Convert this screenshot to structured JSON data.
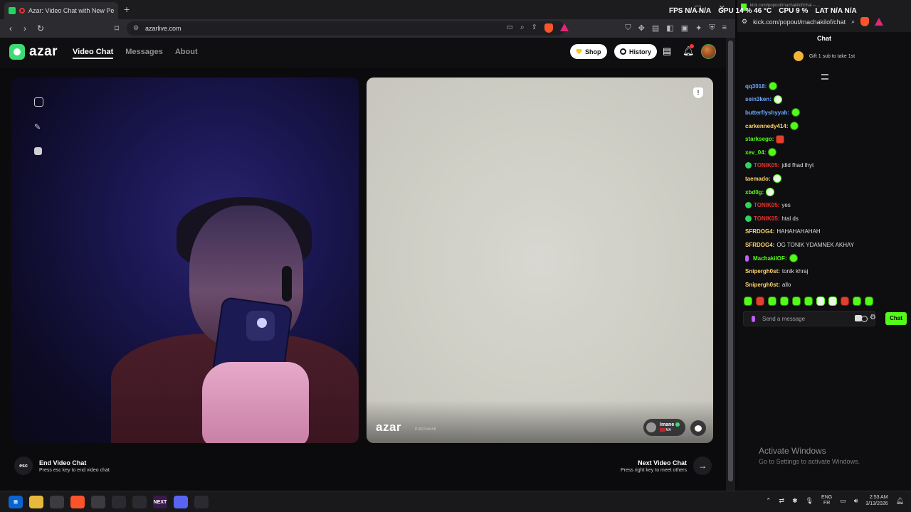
{
  "browser": {
    "tab_title": "Azar: Video Chat with New Pe",
    "tab_close": "×",
    "new_tab": "+",
    "url": "azarlive.com"
  },
  "azar": {
    "logo": "azar",
    "nav": [
      "Video Chat",
      "Messages",
      "About"
    ],
    "shop_label": "Shop",
    "history_label": "History",
    "peer_logo": "azar",
    "peer_code": "P.3917v4nX8",
    "peer_name": "Imane",
    "peer_country": "MA",
    "end_key": "esc",
    "end_title": "End Video Chat",
    "end_sub": "Press esc key to end video chat",
    "next_title": "Next Video Chat",
    "next_sub": "Press right key to meet others",
    "next_arrow": "→"
  },
  "overlay": {
    "fps_label": "FPS",
    "fps_value": "N/A",
    "fps_value2": "N/A",
    "gpu": "GPU  14 %  46 °C",
    "cpu": "CPU  9 %",
    "lat_label": "LAT",
    "lat_value": "N/A",
    "lat_value2": "N/A"
  },
  "kick": {
    "tiny_title": "kick.com/popout/machakilof/chat – ...",
    "url": "kick.com/popout/machakilof/chat",
    "chat_title": "Chat",
    "gift_text": "Gift 1 sub to take 1st",
    "messages": [
      {
        "user": "qq3018",
        "color": "#6fa8ff",
        "text": "",
        "emote": "green",
        "verified": false,
        "mic": false
      },
      {
        "user": "sein3ken",
        "color": "#6fa8ff",
        "text": "",
        "emote": "white",
        "verified": false,
        "mic": false
      },
      {
        "user": "butterflyshyyah",
        "color": "#6fa8ff",
        "text": "",
        "emote": "green",
        "verified": false,
        "mic": false
      },
      {
        "user": "carkennedy414",
        "color": "#ffd36b",
        "text": "",
        "emote": "green",
        "verified": false,
        "mic": false
      },
      {
        "user": "starksego",
        "color": "#53fc18",
        "text": "",
        "emote": "red",
        "verified": false,
        "mic": false
      },
      {
        "user": "xev_04",
        "color": "#53fc18",
        "text": "",
        "emote": "green",
        "verified": false,
        "mic": false
      },
      {
        "user": "TONIK05",
        "color": "#e5342e",
        "text": "jdld fhad lhyt",
        "emote": "",
        "verified": true,
        "mic": false
      },
      {
        "user": "taemado",
        "color": "#ffd36b",
        "text": "",
        "emote": "white",
        "verified": false,
        "mic": false
      },
      {
        "user": "xbd0g",
        "color": "#53fc18",
        "text": "",
        "emote": "white",
        "verified": false,
        "mic": false
      },
      {
        "user": "TONIK05",
        "color": "#e5342e",
        "text": "yes",
        "emote": "",
        "verified": true,
        "mic": false
      },
      {
        "user": "TONIK05",
        "color": "#e5342e",
        "text": "htal ds",
        "emote": "",
        "verified": true,
        "mic": false
      },
      {
        "user": "SFRDOG4",
        "color": "#ffd36b",
        "text": "HAHAHAHAHAH",
        "emote": "",
        "verified": false,
        "mic": false
      },
      {
        "user": "SFRDOG4",
        "color": "#ffd36b",
        "text": "OG TONIK YDAMNEK AKHAY",
        "emote": "",
        "verified": false,
        "mic": false
      },
      {
        "user": "MachakilOF",
        "color": "#53fc18",
        "text": "",
        "emote": "green",
        "verified": false,
        "mic": true
      },
      {
        "user": "Snipergh0st",
        "color": "#ffd36b",
        "text": "tonik khraj",
        "emote": "",
        "verified": false,
        "mic": false
      },
      {
        "user": "Snipergh0st",
        "color": "#ffd36b",
        "text": "allo",
        "emote": "",
        "verified": false,
        "mic": false
      }
    ],
    "emote_bar": [
      "green",
      "red",
      "green",
      "green",
      "green",
      "green",
      "white",
      "white",
      "red",
      "green",
      "green"
    ],
    "input_placeholder": "Send a message",
    "send_label": "Chat",
    "activate_title": "Activate Windows",
    "activate_sub": "Go to Settings to activate Windows."
  },
  "taskbar": {
    "lang_top": "ENG",
    "lang_bottom": "FR",
    "time": "2:53 AM",
    "date": "3/13/2026",
    "next_app": "NEXT"
  }
}
